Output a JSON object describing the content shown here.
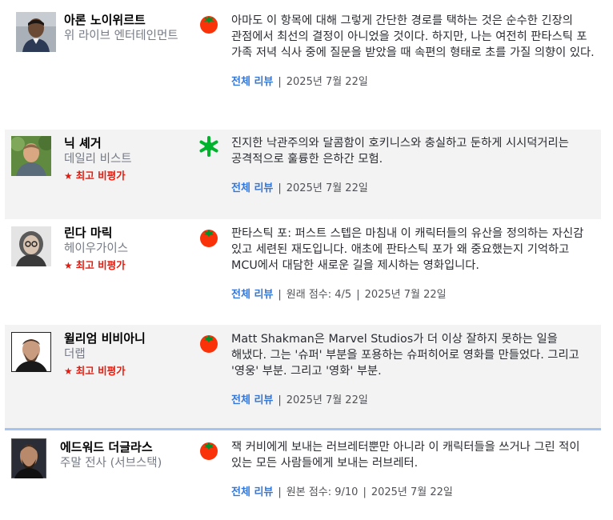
{
  "colors": {
    "link": "#3477d6",
    "top_critic": "#e8190c",
    "fresh_tomato": "#fa320a",
    "splat": "#00b32c",
    "shade": "#f3f3f3",
    "divider": "#a7c4ee"
  },
  "reviews": [
    {
      "critic_name": "아론 노이위르트",
      "publication": "위 라이브 엔터테인먼트",
      "top_critic": false,
      "score": "fresh",
      "score_icon": "tomato-icon",
      "quote": "아마도 이 항목에 대해 그렇게 간단한 경로를 택하는 것은 순수한 긴장의 관점에서 최선의 결정이 아니었을 것이다. 하지만, 나는 여전히 판타스틱 포 가족 저녁 식사 중에 질문을 받았을 때 속편의 형태로 초를 가질 의향이 있다.",
      "full_review_label": "전체 리뷰",
      "original_score": "",
      "date": "2025년 7월 22일"
    },
    {
      "critic_name": "닉 셰거",
      "publication": "데일리 비스트",
      "top_critic": true,
      "top_critic_label": "최고 비평가",
      "score": "rotten",
      "score_icon": "splat-icon",
      "quote": "진지한 낙관주의와 달콤함이 호키니스와 충실하고 둔하게 시시덕거리는 공격적으로 훌륭한 은하간 모험.",
      "full_review_label": "전체 리뷰",
      "original_score": "",
      "date": "2025년 7월 22일"
    },
    {
      "critic_name": "린다 마릭",
      "publication": "헤이우가이스",
      "top_critic": true,
      "top_critic_label": "최고 비평가",
      "score": "fresh",
      "score_icon": "tomato-icon",
      "quote": "판타스틱 포: 퍼스트 스텝은 마침내 이 캐릭터들의 유산을 정의하는 자신감 있고 세련된 재도입니다. 애초에 판타스틱 포가 왜 중요했는지 기억하고 MCU에서 대담한 새로운 길을 제시하는 영화입니다.",
      "full_review_label": "전체 리뷰",
      "original_score": "원래 점수: 4/5",
      "date": "2025년 7월 22일"
    },
    {
      "critic_name": "윌리엄 비비아니",
      "publication": "더랩",
      "top_critic": true,
      "top_critic_label": "최고 비평가",
      "score": "fresh",
      "score_icon": "tomato-icon",
      "quote": "Matt Shakman은 Marvel Studios가 더 이상 잘하지 못하는 일을 해냈다. 그는 '슈퍼' 부분을 포용하는 슈퍼히어로 영화를 만들었다. 그리고 '영웅' 부분. 그리고 '영화' 부분.",
      "full_review_label": "전체 리뷰",
      "original_score": "",
      "date": "2025년 7월 22일"
    },
    {
      "critic_name": "에드워드 더글라스",
      "publication": "주말 전사 (서브스택)",
      "top_critic": false,
      "score": "fresh",
      "score_icon": "tomato-icon",
      "quote": "잭 커비에게 보내는 러브레터뿐만 아니라 이 캐릭터들을 쓰거나 그린 적이 있는 모든 사람들에게 보내는 러브레터.",
      "full_review_label": "전체 리뷰",
      "original_score": "원본 점수: 9/10",
      "date": "2025년 7월 22일"
    }
  ]
}
